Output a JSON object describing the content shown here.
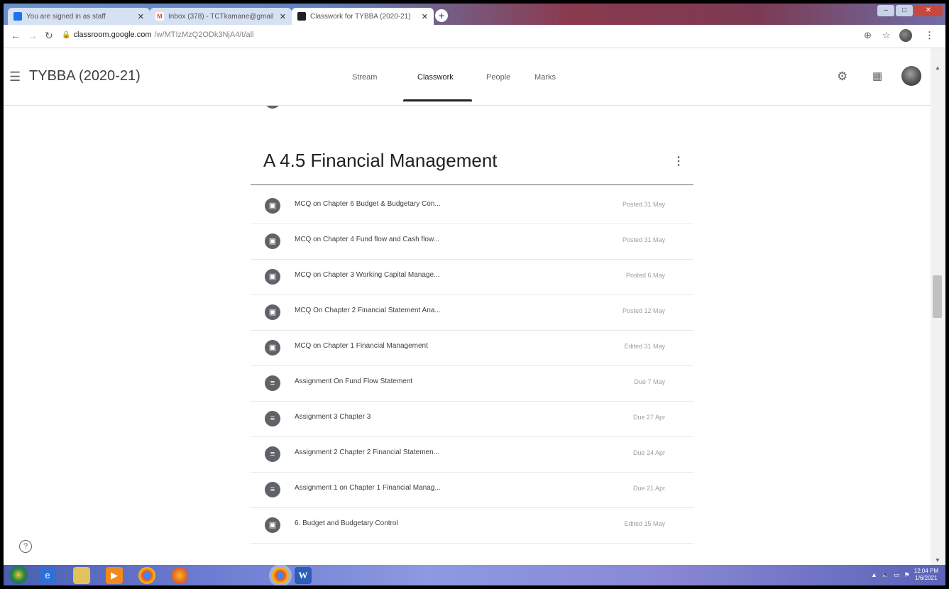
{
  "browser": {
    "tabs": [
      {
        "title": "You are signed in as staff",
        "active": false,
        "favicon_color": "#1a73e8"
      },
      {
        "title": "Inbox (378) - TCTkamane@gmail",
        "active": false,
        "favicon_color": "#ea4335"
      },
      {
        "title": "Classwork for TYBBA (2020-21)",
        "active": true,
        "favicon_color": "#202124"
      }
    ],
    "new_tab_label": "+",
    "url_host": "classroom.google.com",
    "url_path": "/w/MTIzMzQ2ODk3NjA4/t/all"
  },
  "header": {
    "class_name": "TYBBA (2020-21)",
    "nav": [
      "Stream",
      "Classwork",
      "People",
      "Marks"
    ],
    "active_nav": "Classwork"
  },
  "topic": {
    "title": "A 4.5 Financial Management",
    "items": [
      {
        "type": "quiz",
        "title": "MCQ on Chapter 6 Budget & Budgetary Con...",
        "date": "Posted 31 May"
      },
      {
        "type": "quiz",
        "title": "MCQ on Chapter 4 Fund flow and Cash flow...",
        "date": "Posted 31 May"
      },
      {
        "type": "quiz",
        "title": "MCQ on Chapter 3 Working Capital Manage...",
        "date": "Posted 6 May"
      },
      {
        "type": "quiz",
        "title": "MCQ On Chapter 2 Financial Statement Ana...",
        "date": "Posted 12 May"
      },
      {
        "type": "quiz",
        "title": "MCQ on Chapter 1 Financial Management",
        "date": "Edited 31 May"
      },
      {
        "type": "assignment",
        "title": "Assignment On Fund Flow Statement",
        "date": "Due 7 May"
      },
      {
        "type": "assignment",
        "title": "Assignment 3 Chapter 3",
        "date": "Due 27 Apr"
      },
      {
        "type": "assignment",
        "title": "Assignment 2 Chapter 2 Financial Statemen...",
        "date": "Due 24 Apr"
      },
      {
        "type": "assignment",
        "title": "Assignment 1 on Chapter 1 Financial Manag...",
        "date": "Due 21 Apr"
      },
      {
        "type": "quiz",
        "title": "6. Budget and Budgetary Control",
        "date": "Edited 15 May"
      }
    ]
  },
  "icons": {
    "quiz": "quiz-assignment-icon",
    "assignment": "assignment-icon"
  },
  "taskbar": {
    "clock_time": "12:04 PM",
    "clock_date": "1/6/2021",
    "word_label": "W"
  }
}
